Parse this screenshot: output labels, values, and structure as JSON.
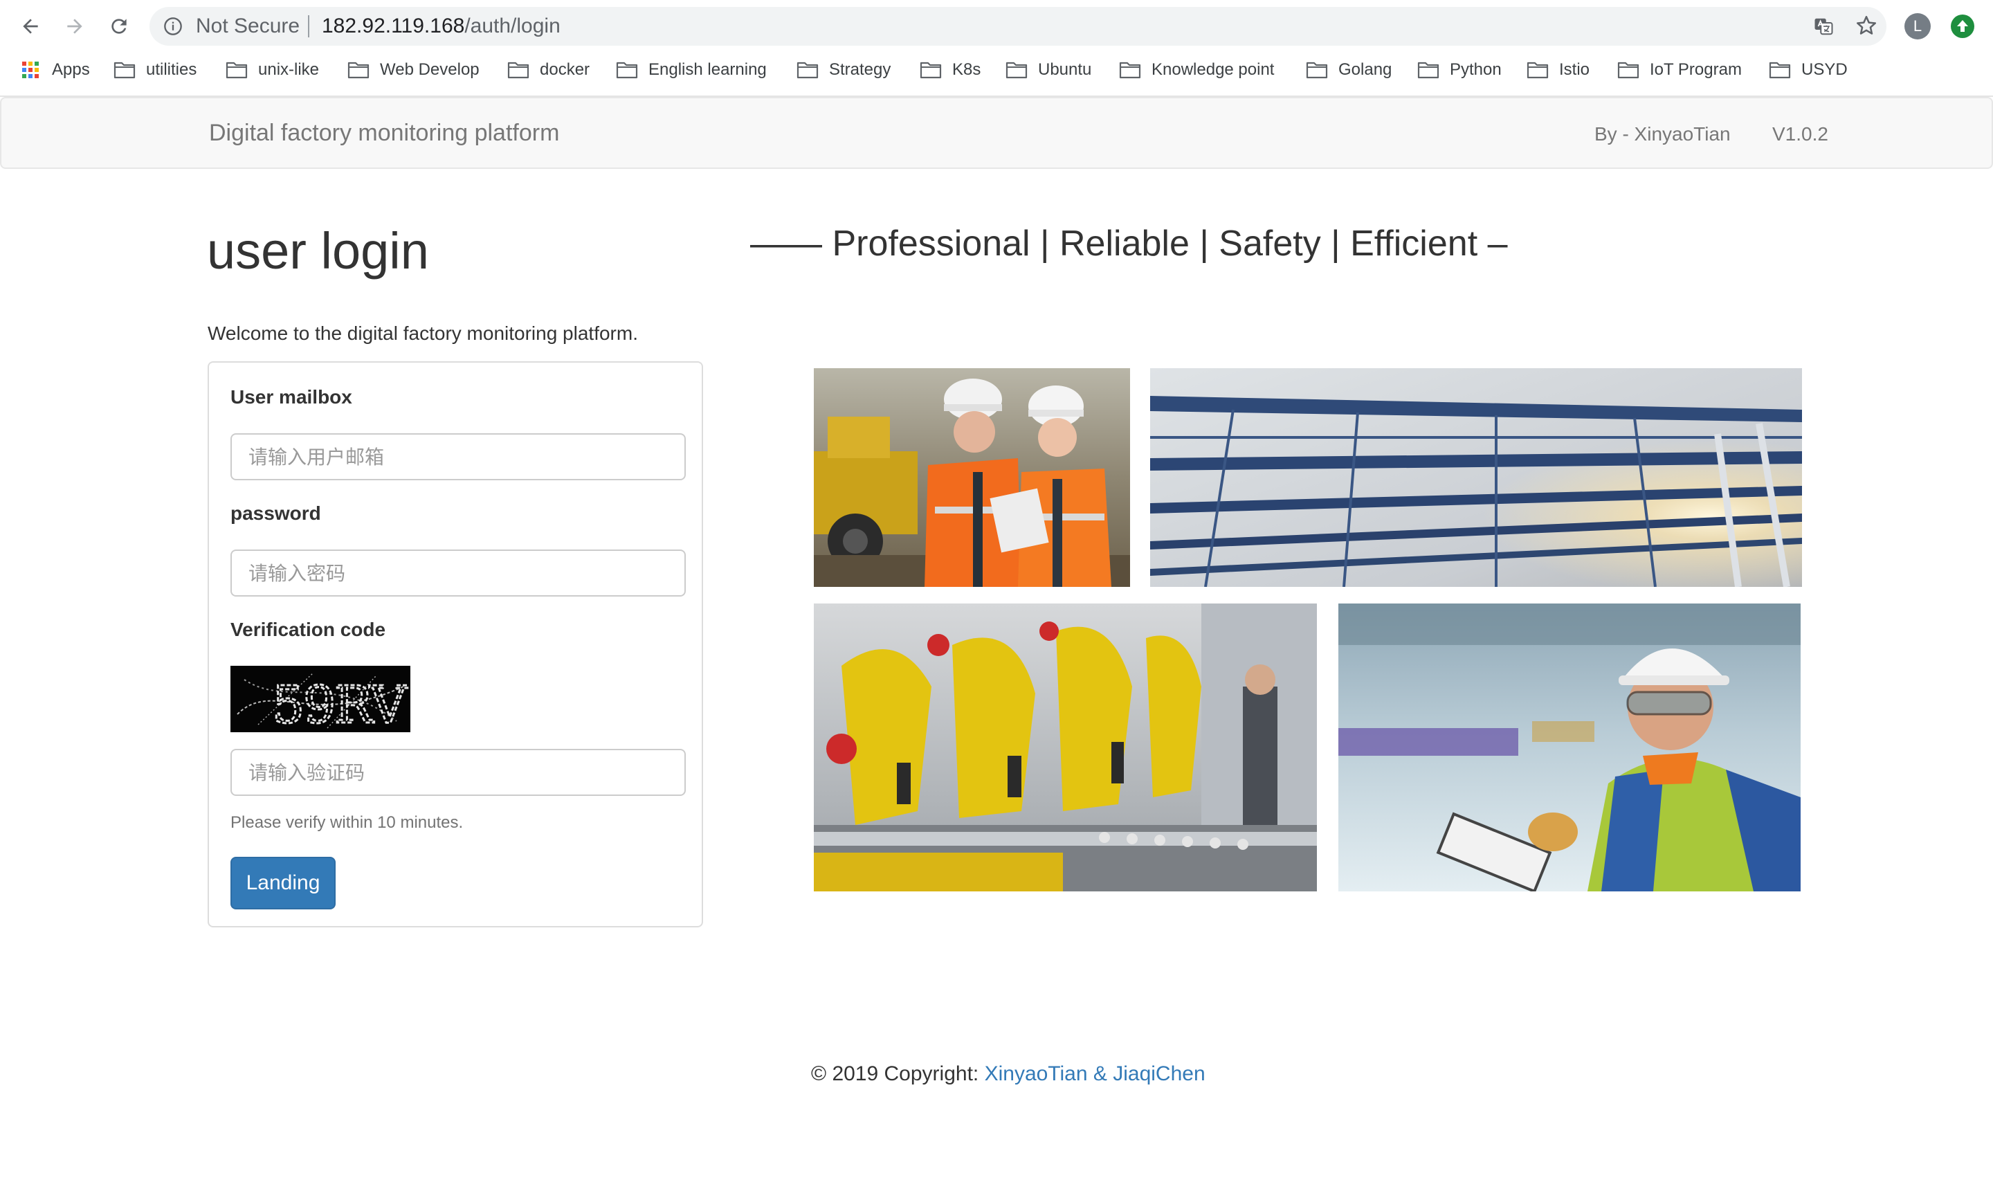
{
  "browser": {
    "security_label": "Not Secure",
    "url_host": "182.92.119.168",
    "url_path": "/auth/login",
    "avatar_letter": "L",
    "bookmarks": [
      {
        "label": "Apps",
        "icon": "apps-grid-icon"
      },
      {
        "label": "utilities",
        "icon": "folder-icon"
      },
      {
        "label": "unix-like",
        "icon": "folder-icon"
      },
      {
        "label": "Web Develop",
        "icon": "folder-icon"
      },
      {
        "label": "docker",
        "icon": "folder-icon"
      },
      {
        "label": "English learning",
        "icon": "folder-icon"
      },
      {
        "label": "Strategy",
        "icon": "folder-icon"
      },
      {
        "label": "K8s",
        "icon": "folder-icon"
      },
      {
        "label": "Ubuntu",
        "icon": "folder-icon"
      },
      {
        "label": "Knowledge point",
        "icon": "folder-icon"
      },
      {
        "label": "Golang",
        "icon": "folder-icon"
      },
      {
        "label": "Python",
        "icon": "folder-icon"
      },
      {
        "label": "Istio",
        "icon": "folder-icon"
      },
      {
        "label": "IoT Program",
        "icon": "folder-icon"
      },
      {
        "label": "USYD",
        "icon": "folder-icon"
      }
    ]
  },
  "navbar": {
    "brand": "Digital factory monitoring platform",
    "author": "By - XinyaoTian",
    "version": "V1.0.2"
  },
  "login": {
    "title": "user login",
    "welcome": "Welcome to the digital factory monitoring platform.",
    "email_label": "User mailbox",
    "email_placeholder": "请输入用户邮箱",
    "password_label": "password",
    "password_placeholder": "请输入密码",
    "captcha_label": "Verification code",
    "captcha_text": "59RV",
    "captcha_placeholder": "请输入验证码",
    "help_text": "Please verify within 10 minutes.",
    "submit_label": "Landing"
  },
  "hero": {
    "slogan": "—— Professional | Reliable | Safety | Efficient –",
    "photos": [
      "engineers-with-tablet-photo",
      "steel-roof-structure-photo",
      "yellow-robot-arms-photo",
      "worker-with-clipboard-photo"
    ]
  },
  "footer": {
    "copyright_prefix": "© 2019 Copyright: ",
    "authors_link": "XinyaoTian & JiaqiChen"
  },
  "colors": {
    "primary": "#337ab7",
    "navbar_bg": "#f8f8f8",
    "text": "#333333"
  }
}
